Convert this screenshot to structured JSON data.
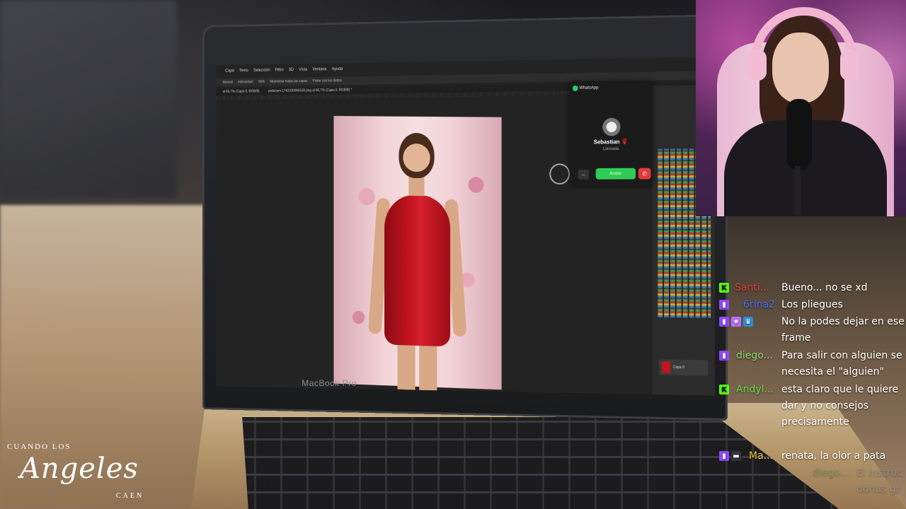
{
  "photoshop": {
    "menu": [
      "Capa",
      "Texto",
      "Selección",
      "Filtro",
      "3D",
      "Vista",
      "Ventana",
      "Ayuda"
    ],
    "options": [
      "Normal",
      "Intensidad:",
      "50%",
      "Muestrear todas las capas",
      "Pintar con los dedos"
    ],
    "tabs": [
      "al 66,7% (Capa 0, RGB/8)",
      "pixlsnom-1742330966530.png al 66,7% (Capa 0, RGB/8) *"
    ],
    "layer_name": "Capa 0"
  },
  "whatsapp": {
    "app_name": "WhatsApp",
    "caller": "Sebastian 🌹",
    "status": "Llamada",
    "accept": "Aceptar",
    "dismiss": "–",
    "decline": "✆"
  },
  "laptop": {
    "brand": "MacBook Pro"
  },
  "chat": [
    {
      "badges": [
        "k"
      ],
      "user": "Santi...",
      "color": "#e0443a",
      "msg": "Bueno... no se xd"
    },
    {
      "badges": [
        "twitch"
      ],
      "user": "6rina2",
      "color": "#2c4de8",
      "msg": "Los pliegues"
    },
    {
      "badges": [
        "twitch",
        "star",
        "crown"
      ],
      "user": "",
      "color": "#ffffff",
      "msg": "No la podes dejar en ese frame"
    },
    {
      "badges": [
        "twitch"
      ],
      "user": "diego...",
      "color": "#8fd66b",
      "msg": "Para salir con alguien se necesita el \"alguien\""
    },
    {
      "badges": [
        "k"
      ],
      "user": "Andyl...",
      "color": "#6bdc4a",
      "msg": "esta claro que le quiere dar y no consejos precisamente"
    },
    {
      "badges": [
        "twitch",
        "mod"
      ],
      "user": "Ma...",
      "color": "#f0c030",
      "msg": "renata, la olor a pata"
    },
    {
      "badges": [],
      "user": "diego...",
      "color": "#6a9a5a",
      "msg": "El instruc donas gr"
    }
  ],
  "logo": {
    "top": "CUANDO LOS",
    "main": "Angeles",
    "bottom": "CAEN"
  }
}
